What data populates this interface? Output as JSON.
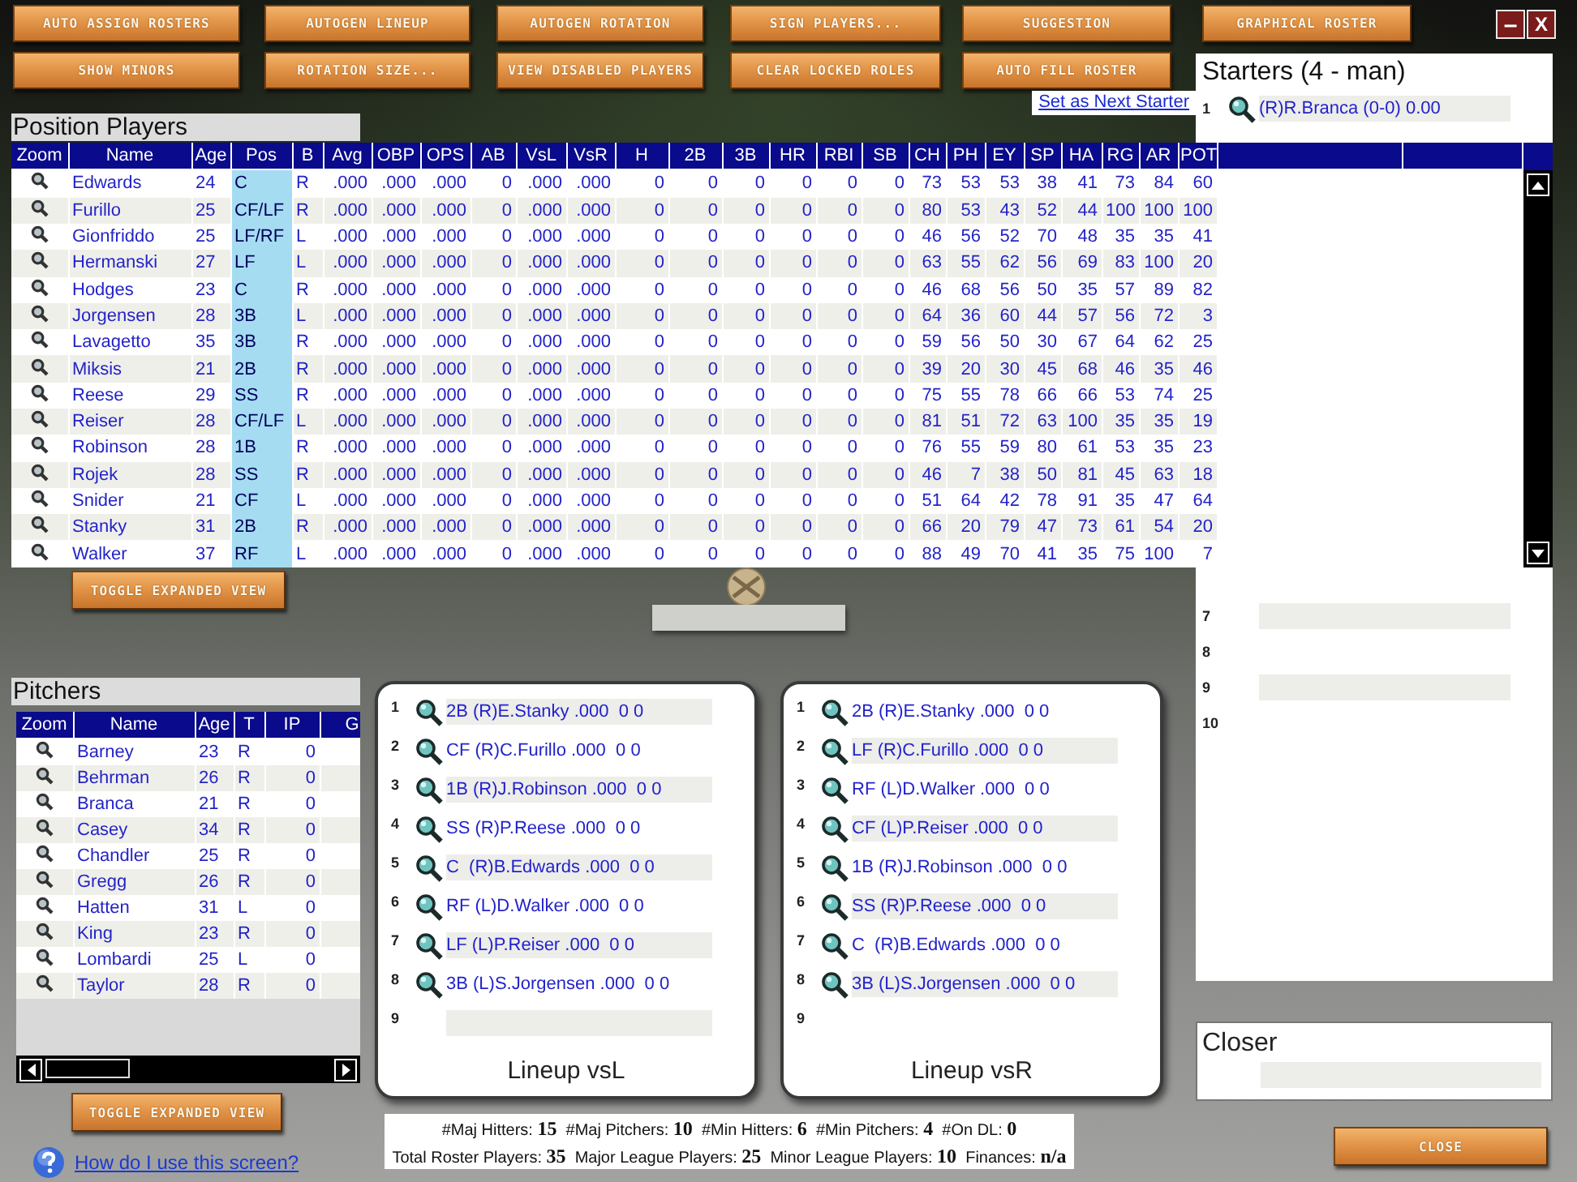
{
  "toolbar": {
    "buttons": [
      {
        "label": "AUTO ASSIGN ROSTERS"
      },
      {
        "label": "AUTOGEN LINEUP"
      },
      {
        "label": "AUTOGEN ROTATION"
      },
      {
        "label": "SIGN PLAYERS..."
      },
      {
        "label": "SUGGESTION"
      },
      {
        "label": "GRAPHICAL ROSTER"
      },
      {
        "label": "SHOW MINORS"
      },
      {
        "label": "ROTATION SIZE..."
      },
      {
        "label": "VIEW DISABLED PLAYERS"
      },
      {
        "label": "CLEAR LOCKED ROLES"
      },
      {
        "label": "AUTO FILL ROSTER"
      }
    ],
    "window_controls": [
      {
        "kind": "minimize",
        "label": "–"
      },
      {
        "kind": "close",
        "label": "X"
      }
    ]
  },
  "starters": {
    "title": "Starters (4 - man)",
    "link": "Set as Next Starter",
    "slots": [
      {
        "number": "1",
        "player": "(R)R.Branca (0-0) 0.00"
      },
      {
        "number": "7"
      },
      {
        "number": "8"
      },
      {
        "number": "9"
      },
      {
        "number": "10"
      }
    ]
  },
  "position_players": {
    "title": "Position Players",
    "columns": [
      "Zoom",
      "Name",
      "Age",
      "Pos",
      "B",
      "Avg",
      "OBP",
      "OPS",
      "AB",
      "VsL",
      "VsR",
      "H",
      "2B",
      "3B",
      "HR",
      "RBI",
      "SB",
      "CH",
      "PH",
      "EY",
      "SP",
      "HA",
      "RG",
      "AR",
      "POT"
    ],
    "rows": [
      {
        "cells": [
          "",
          "Edwards",
          "24",
          "C",
          "R",
          ".000",
          ".000",
          ".000",
          "0",
          ".000",
          ".000",
          "0",
          "0",
          "0",
          "0",
          "0",
          "0",
          "73",
          "53",
          "53",
          "38",
          "41",
          "73",
          "84",
          "60"
        ]
      },
      {
        "cells": [
          "",
          "Furillo",
          "25",
          "CF/LF",
          "R",
          ".000",
          ".000",
          ".000",
          "0",
          ".000",
          ".000",
          "0",
          "0",
          "0",
          "0",
          "0",
          "0",
          "80",
          "53",
          "43",
          "52",
          "44",
          "100",
          "100",
          "100"
        ]
      },
      {
        "cells": [
          "",
          "Gionfriddo",
          "25",
          "LF/RF",
          "L",
          ".000",
          ".000",
          ".000",
          "0",
          ".000",
          ".000",
          "0",
          "0",
          "0",
          "0",
          "0",
          "0",
          "46",
          "56",
          "52",
          "70",
          "48",
          "35",
          "35",
          "41"
        ]
      },
      {
        "cells": [
          "",
          "Hermanski",
          "27",
          "LF",
          "L",
          ".000",
          ".000",
          ".000",
          "0",
          ".000",
          ".000",
          "0",
          "0",
          "0",
          "0",
          "0",
          "0",
          "63",
          "55",
          "62",
          "56",
          "69",
          "83",
          "100",
          "20"
        ]
      },
      {
        "cells": [
          "",
          "Hodges",
          "23",
          "C",
          "R",
          ".000",
          ".000",
          ".000",
          "0",
          ".000",
          ".000",
          "0",
          "0",
          "0",
          "0",
          "0",
          "0",
          "46",
          "68",
          "56",
          "50",
          "35",
          "57",
          "89",
          "82"
        ]
      },
      {
        "cells": [
          "",
          "Jorgensen",
          "28",
          "3B",
          "L",
          ".000",
          ".000",
          ".000",
          "0",
          ".000",
          ".000",
          "0",
          "0",
          "0",
          "0",
          "0",
          "0",
          "64",
          "36",
          "60",
          "44",
          "57",
          "56",
          "72",
          "3"
        ]
      },
      {
        "cells": [
          "",
          "Lavagetto",
          "35",
          "3B",
          "R",
          ".000",
          ".000",
          ".000",
          "0",
          ".000",
          ".000",
          "0",
          "0",
          "0",
          "0",
          "0",
          "0",
          "59",
          "56",
          "50",
          "30",
          "67",
          "64",
          "62",
          "25"
        ]
      },
      {
        "cells": [
          "",
          "Miksis",
          "21",
          "2B",
          "R",
          ".000",
          ".000",
          ".000",
          "0",
          ".000",
          ".000",
          "0",
          "0",
          "0",
          "0",
          "0",
          "0",
          "39",
          "20",
          "30",
          "45",
          "68",
          "46",
          "35",
          "46"
        ]
      },
      {
        "cells": [
          "",
          "Reese",
          "29",
          "SS",
          "R",
          ".000",
          ".000",
          ".000",
          "0",
          ".000",
          ".000",
          "0",
          "0",
          "0",
          "0",
          "0",
          "0",
          "75",
          "55",
          "78",
          "66",
          "66",
          "53",
          "74",
          "25"
        ]
      },
      {
        "cells": [
          "",
          "Reiser",
          "28",
          "CF/LF",
          "L",
          ".000",
          ".000",
          ".000",
          "0",
          ".000",
          ".000",
          "0",
          "0",
          "0",
          "0",
          "0",
          "0",
          "81",
          "51",
          "72",
          "63",
          "100",
          "35",
          "35",
          "19"
        ]
      },
      {
        "cells": [
          "",
          "Robinson",
          "28",
          "1B",
          "R",
          ".000",
          ".000",
          ".000",
          "0",
          ".000",
          ".000",
          "0",
          "0",
          "0",
          "0",
          "0",
          "0",
          "76",
          "55",
          "59",
          "80",
          "61",
          "53",
          "35",
          "23"
        ]
      },
      {
        "cells": [
          "",
          "Rojek",
          "28",
          "SS",
          "R",
          ".000",
          ".000",
          ".000",
          "0",
          ".000",
          ".000",
          "0",
          "0",
          "0",
          "0",
          "0",
          "0",
          "46",
          "7",
          "38",
          "50",
          "81",
          "45",
          "63",
          "18"
        ]
      },
      {
        "cells": [
          "",
          "Snider",
          "21",
          "CF",
          "L",
          ".000",
          ".000",
          ".000",
          "0",
          ".000",
          ".000",
          "0",
          "0",
          "0",
          "0",
          "0",
          "0",
          "51",
          "64",
          "42",
          "78",
          "91",
          "35",
          "47",
          "64"
        ]
      },
      {
        "cells": [
          "",
          "Stanky",
          "31",
          "2B",
          "R",
          ".000",
          ".000",
          ".000",
          "0",
          ".000",
          ".000",
          "0",
          "0",
          "0",
          "0",
          "0",
          "0",
          "66",
          "20",
          "79",
          "47",
          "73",
          "61",
          "54",
          "20"
        ]
      },
      {
        "cells": [
          "",
          "Walker",
          "37",
          "RF",
          "L",
          ".000",
          ".000",
          ".000",
          "0",
          ".000",
          ".000",
          "0",
          "0",
          "0",
          "0",
          "0",
          "0",
          "88",
          "49",
          "70",
          "41",
          "35",
          "75",
          "100",
          "7"
        ]
      }
    ]
  },
  "toggle_buttons": [
    {
      "label": "TOGGLE EXPANDED VIEW"
    },
    {
      "label": "TOGGLE EXPANDED VIEW"
    }
  ],
  "pitchers": {
    "title": "Pitchers",
    "columns": [
      "Zoom",
      "Name",
      "Age",
      "T",
      "IP",
      "G"
    ],
    "rows": [
      {
        "cells": [
          "",
          "Barney",
          "23",
          "R",
          "0"
        ]
      },
      {
        "cells": [
          "",
          "Behrman",
          "26",
          "R",
          "0"
        ]
      },
      {
        "cells": [
          "",
          "Branca",
          "21",
          "R",
          "0"
        ]
      },
      {
        "cells": [
          "",
          "Casey",
          "34",
          "R",
          "0"
        ]
      },
      {
        "cells": [
          "",
          "Chandler",
          "25",
          "R",
          "0"
        ]
      },
      {
        "cells": [
          "",
          "Gregg",
          "26",
          "R",
          "0"
        ]
      },
      {
        "cells": [
          "",
          "Hatten",
          "31",
          "L",
          "0"
        ]
      },
      {
        "cells": [
          "",
          "King",
          "23",
          "R",
          "0"
        ]
      },
      {
        "cells": [
          "",
          "Lombardi",
          "25",
          "L",
          "0"
        ]
      },
      {
        "cells": [
          "",
          "Taylor",
          "28",
          "R",
          "0"
        ]
      }
    ]
  },
  "lineups": [
    {
      "caption": "Lineup vsL",
      "slots": [
        {
          "number": "1",
          "player": "2B (R)E.Stanky .000  0 0"
        },
        {
          "number": "2",
          "player": "CF (R)C.Furillo .000  0 0"
        },
        {
          "number": "3",
          "player": "1B (R)J.Robinson .000  0 0"
        },
        {
          "number": "4",
          "player": "SS (R)P.Reese .000  0 0"
        },
        {
          "number": "5",
          "player": "C  (R)B.Edwards .000  0 0"
        },
        {
          "number": "6",
          "player": "RF (L)D.Walker .000  0 0"
        },
        {
          "number": "7",
          "player": "LF (L)P.Reiser .000  0 0"
        },
        {
          "number": "8",
          "player": "3B (L)S.Jorgensen .000  0 0"
        },
        {
          "number": "9"
        }
      ]
    },
    {
      "caption": "Lineup vsR",
      "slots": [
        {
          "number": "1",
          "player": "2B (R)E.Stanky .000  0 0"
        },
        {
          "number": "2",
          "player": "LF (R)C.Furillo .000  0 0"
        },
        {
          "number": "3",
          "player": "RF (L)D.Walker .000  0 0"
        },
        {
          "number": "4",
          "player": "CF (L)P.Reiser .000  0 0"
        },
        {
          "number": "5",
          "player": "1B (R)J.Robinson .000  0 0"
        },
        {
          "number": "6",
          "player": "SS (R)P.Reese .000  0 0"
        },
        {
          "number": "7",
          "player": "C  (R)B.Edwards .000  0 0"
        },
        {
          "number": "8",
          "player": "3B (L)S.Jorgensen .000  0 0"
        },
        {
          "number": "9"
        }
      ]
    }
  ],
  "closer": {
    "title": "Closer"
  },
  "summary": {
    "lines": [
      "#Maj Hitters: **15**  #Maj Pitchers: **10**  #Min Hitters: **6**  #Min Pitchers: **4**  #On DL: **0**",
      "Total Roster Players: **35**  Major League Players: **25**  Minor League Players: **10**  Finances: **n/a**"
    ]
  },
  "help": {
    "link": "How do I use this screen?"
  },
  "close_button": {
    "label": "CLOSE"
  }
}
